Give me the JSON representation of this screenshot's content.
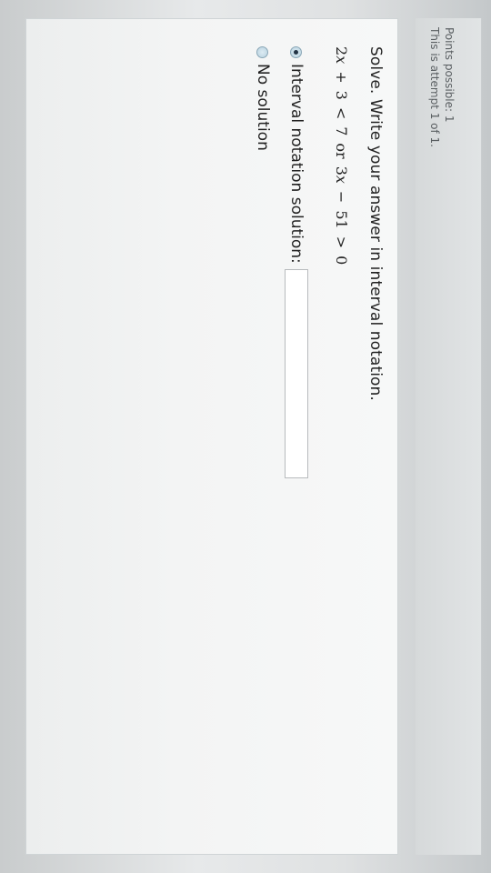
{
  "question": {
    "instruction": "Solve. Write your answer in interval notation.",
    "equation": {
      "part1_coef": "2",
      "part1_var": "x",
      "part1_op": "+",
      "part1_const": "3",
      "part1_rel": "<",
      "part1_rhs": "7",
      "joiner": "or",
      "part2_coef": "3",
      "part2_var": "x",
      "part2_op": "−",
      "part2_const": "51",
      "part2_rel": ">",
      "part2_rhs": "0"
    },
    "options": [
      {
        "label": "Interval notation solution:",
        "selected": true
      },
      {
        "label": "No solution",
        "selected": false
      }
    ],
    "answer_value": ""
  },
  "meta": {
    "points_possible": "Points possible: 1",
    "attempt": "This is attempt 1 of 1."
  }
}
